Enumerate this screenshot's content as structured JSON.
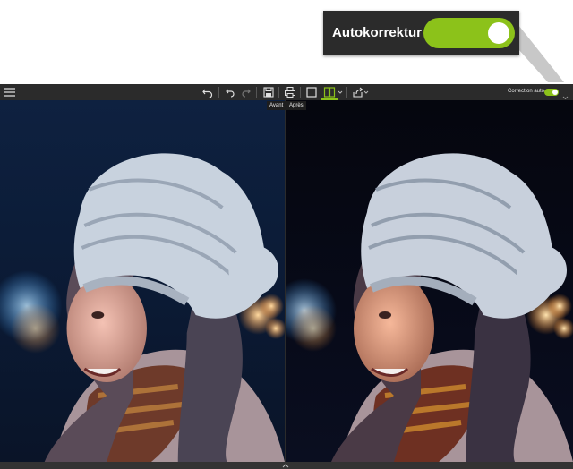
{
  "callout": {
    "label": "Autokorrektur",
    "toggle_state": "on",
    "accent_color": "#8cc21a"
  },
  "toolbar": {
    "menu_icon": "hamburger-icon",
    "undo_icon": "undo-icon",
    "undo_step_icon": "undo-step-icon",
    "redo_icon": "redo-icon",
    "save_icon": "save-icon",
    "print_icon": "print-icon",
    "single_view_icon": "single-view-icon",
    "split_view_icon": "split-view-icon",
    "share_icon": "share-icon",
    "auto_correction_label": "Correction auto",
    "auto_correction_state": "on"
  },
  "tooltips": {
    "before": "Avant",
    "after": "Après"
  },
  "colors": {
    "toolbar_bg": "#2b2b2b",
    "accent": "#8cc21a"
  }
}
